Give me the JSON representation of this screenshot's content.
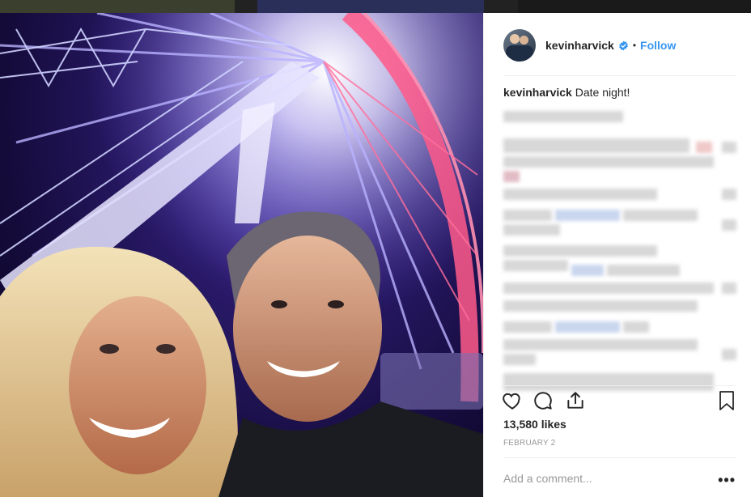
{
  "post": {
    "username": "kevinharvick",
    "verified": true,
    "follow_label": "Follow",
    "separator": "•",
    "caption_user": "kevinharvick",
    "caption_text": "Date night!",
    "likes": "13,580 likes",
    "date": "FEBRUARY 2",
    "comment_placeholder": "Add a comment...",
    "more_label": "•••"
  },
  "icons": {
    "like": "heart-icon",
    "comment": "comment-icon",
    "share": "share-icon",
    "save": "bookmark-icon"
  },
  "colors": {
    "accent": "#3897f0",
    "text": "#262626",
    "muted": "#999999"
  }
}
